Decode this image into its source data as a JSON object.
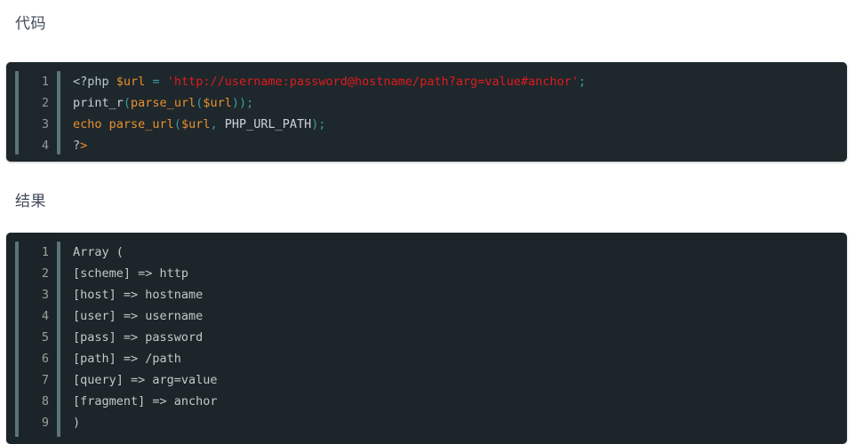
{
  "headings": {
    "code": "代码",
    "result": "结果"
  },
  "code_block": {
    "language": "php",
    "line_numbers": [
      "1",
      "2",
      "3",
      "4"
    ],
    "lines": [
      {
        "number": "1",
        "text": "<?php $url = 'http://username:password@hostname/path?arg=value#anchor';",
        "tokens": [
          {
            "text": "<?php",
            "type": "tag",
            "color": "#b8c8d0"
          },
          {
            "text": " ",
            "type": "plain",
            "color": "#c9d3d7"
          },
          {
            "text": "$url",
            "type": "var",
            "color": "#e8912d"
          },
          {
            "text": " ",
            "type": "plain",
            "color": "#c9d3d7"
          },
          {
            "text": "=",
            "type": "op",
            "color": "#3a9e9e"
          },
          {
            "text": " ",
            "type": "plain",
            "color": "#c9d3d7"
          },
          {
            "text": "'http://username:password@hostname/path?arg=value#anchor'",
            "type": "string",
            "color": "#e01b1b"
          },
          {
            "text": ";",
            "type": "punc",
            "color": "#3a9e9e"
          }
        ]
      },
      {
        "number": "2",
        "text": "print_r(parse_url($url));",
        "tokens": [
          {
            "text": "print_r",
            "type": "plain",
            "color": "#c9d3d7"
          },
          {
            "text": "(",
            "type": "punc",
            "color": "#3a9e9e"
          },
          {
            "text": "parse_url",
            "type": "func",
            "color": "#e8912d"
          },
          {
            "text": "(",
            "type": "punc",
            "color": "#3a9e9e"
          },
          {
            "text": "$url",
            "type": "var",
            "color": "#e8912d"
          },
          {
            "text": "));",
            "type": "punc",
            "color": "#3a9e9e"
          }
        ]
      },
      {
        "number": "3",
        "text": "echo parse_url($url, PHP_URL_PATH);",
        "tokens": [
          {
            "text": "echo",
            "type": "kw",
            "color": "#e8912d"
          },
          {
            "text": " ",
            "type": "plain",
            "color": "#c9d3d7"
          },
          {
            "text": "parse_url",
            "type": "func",
            "color": "#e8912d"
          },
          {
            "text": "(",
            "type": "punc",
            "color": "#3a9e9e"
          },
          {
            "text": "$url",
            "type": "var",
            "color": "#e8912d"
          },
          {
            "text": ", ",
            "type": "punc",
            "color": "#3a9e9e"
          },
          {
            "text": "PHP_URL_PATH",
            "type": "const",
            "color": "#c9d3d7"
          },
          {
            "text": ");",
            "type": "punc",
            "color": "#3a9e9e"
          }
        ]
      },
      {
        "number": "4",
        "text": "?>",
        "tokens": [
          {
            "text": "?",
            "type": "tag",
            "color": "#b8c8d0"
          },
          {
            "text": ">",
            "type": "kw",
            "color": "#e8912d"
          }
        ]
      }
    ]
  },
  "result_block": {
    "line_numbers": [
      "1",
      "2",
      "3",
      "4",
      "5",
      "6",
      "7",
      "8",
      "9"
    ],
    "lines": [
      "Array (",
      "[scheme] => http",
      "[host] => hostname",
      "[user] => username",
      "[pass] => password",
      "[path] => /path",
      "[query] => arg=value",
      "[fragment] => anchor",
      ")"
    ]
  },
  "colors": {
    "page_background": "#ffffff",
    "heading_text": "#3f4a5a",
    "code_background": "#1e272c",
    "result_background": "#1c2529",
    "gutter_rail": "#5b7478",
    "line_number": "#8d9aa0",
    "code_default_text": "#c6d0d4",
    "result_text": "#bfcbc8",
    "accent_variable": "#e8912d",
    "accent_string": "#e01b1b",
    "accent_operator": "#3a9e9e"
  }
}
